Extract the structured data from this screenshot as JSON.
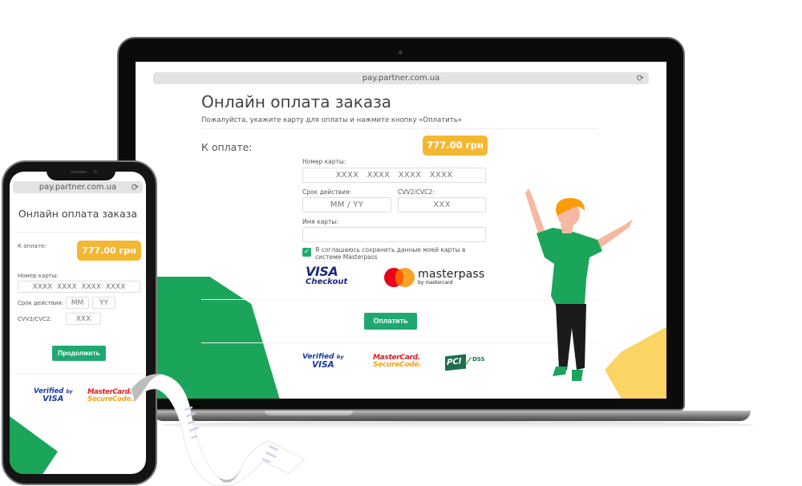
{
  "laptop": {
    "browser": {
      "url": "pay.partner.com.ua",
      "reload_icon": "reload-icon"
    },
    "page": {
      "title": "Онлайн оплата заказа",
      "subtitle": "Пожалуйста, укажите карту для оплаты и нажмите кнопку «Оплатить»",
      "amount_label": "К оплате:",
      "amount_value": "777.00 грн",
      "card_number": {
        "label": "Номер карты:",
        "placeholder": "XXXX   XXXX   XXXX   XXXX",
        "value": ""
      },
      "expiry": {
        "label": "Срок действия:",
        "placeholder": "MM / YY",
        "value": ""
      },
      "cvv": {
        "label": "CVV2/CVC2:",
        "placeholder": "XXX",
        "value": ""
      },
      "card_name": {
        "label": "Имя карты:",
        "placeholder": "",
        "value": ""
      },
      "save_checkbox": {
        "checked": true,
        "label": "Я соглашаюсь сохранить данные моей карты в системе Masterpass"
      },
      "visa_checkout": {
        "line1": "VISA",
        "line2": "Checkout"
      },
      "masterpass": {
        "line1": "masterpass",
        "line2": "by mastercard"
      },
      "pay_button": "Оплатить",
      "badges": {
        "verified_by_visa": {
          "line1": "Verified",
          "by": "by",
          "line2": "VISA"
        },
        "mastercard_securecode": {
          "line1": "MasterCard.",
          "line2": "SecureCode."
        },
        "pci_dss": {
          "pci": "PCI",
          "dss": "DSS"
        }
      }
    }
  },
  "phone": {
    "browser": {
      "url": "pay.partner.com.ua",
      "reload_icon": "reload-icon"
    },
    "page": {
      "title": "Онлайн оплата заказа",
      "amount_label": "К оплате:",
      "amount_value": "777.00 грн",
      "card_number": {
        "label": "Номер карты:",
        "placeholder": "XXXX  XXXX  XXXX  XXXX",
        "value": ""
      },
      "expiry": {
        "label": "Срок действия:",
        "month_placeholder": "MM",
        "year_placeholder": "YY"
      },
      "cvv": {
        "label": "CVV2/CVC2:",
        "placeholder": "XXX"
      },
      "continue_button": "Продолжить",
      "badges": {
        "verified_by_visa": {
          "line1": "Verified",
          "by": "by",
          "line2": "VISA"
        },
        "mastercard_securecode": {
          "line1": "MasterCard.",
          "line2": "SecureCode."
        }
      }
    }
  },
  "colors": {
    "green_accent": "#1fa971",
    "green_shape": "#1aa55a",
    "amount_badge": "#f4b731",
    "yellow_shape": "#fad464",
    "visa_blue": "#1a2a7f",
    "mastercard_red": "#eb001b",
    "mastercard_orange": "#f79e1b"
  }
}
